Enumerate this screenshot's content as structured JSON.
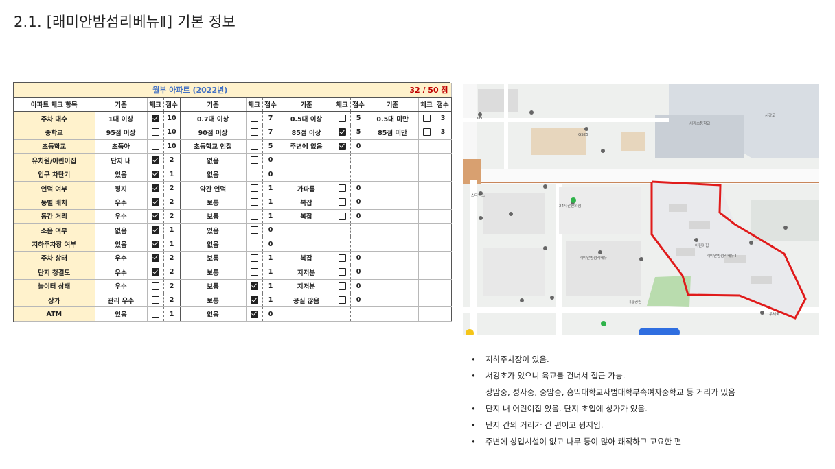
{
  "page_title": "2.1. [래미안밤섬리베뉴Ⅱ] 기본 정보",
  "sheet": {
    "heading": "월부 아파트 (2022년)",
    "score_total": "32 / 50 점",
    "headers": [
      "아파트 체크 항목",
      "기준",
      "체크",
      "점수",
      "기준",
      "체크",
      "점수",
      "기준",
      "체크",
      "점수",
      "기준",
      "체크",
      "점수"
    ],
    "rows": [
      {
        "item": "주차 대수",
        "groups": [
          {
            "basis": "1대 이상",
            "checked": true,
            "pt": "10"
          },
          {
            "basis": "0.7대 이상",
            "checked": false,
            "pt": "7"
          },
          {
            "basis": "0.5대 이상",
            "checked": false,
            "pt": "5"
          },
          {
            "basis": "0.5대 미만",
            "checked": false,
            "pt": "3"
          }
        ]
      },
      {
        "item": "중학교",
        "groups": [
          {
            "basis": "95점 이상",
            "checked": false,
            "pt": "10"
          },
          {
            "basis": "90점 이상",
            "checked": false,
            "pt": "7"
          },
          {
            "basis": "85점 이상",
            "checked": true,
            "pt": "5"
          },
          {
            "basis": "85점 미만",
            "checked": false,
            "pt": "3"
          }
        ]
      },
      {
        "item": "초등학교",
        "groups": [
          {
            "basis": "초품아",
            "checked": false,
            "pt": "10"
          },
          {
            "basis": "초등학교 인접",
            "checked": false,
            "pt": "5"
          },
          {
            "basis": "주변에 없음",
            "checked": true,
            "pt": "0"
          },
          null
        ]
      },
      {
        "item": "유치원/어린이집",
        "groups": [
          {
            "basis": "단지 내",
            "checked": true,
            "pt": "2"
          },
          {
            "basis": "없음",
            "checked": false,
            "pt": "0"
          },
          null,
          null
        ]
      },
      {
        "item": "입구 차단기",
        "groups": [
          {
            "basis": "있음",
            "checked": true,
            "pt": "1"
          },
          {
            "basis": "없음",
            "checked": false,
            "pt": "0"
          },
          null,
          null
        ]
      },
      {
        "item": "언덕 여부",
        "groups": [
          {
            "basis": "평지",
            "checked": true,
            "pt": "2"
          },
          {
            "basis": "약간 언덕",
            "checked": false,
            "pt": "1"
          },
          {
            "basis": "가파름",
            "checked": false,
            "pt": "0"
          },
          null
        ]
      },
      {
        "item": "동별 배치",
        "groups": [
          {
            "basis": "우수",
            "checked": true,
            "pt": "2"
          },
          {
            "basis": "보통",
            "checked": false,
            "pt": "1"
          },
          {
            "basis": "복잡",
            "checked": false,
            "pt": "0"
          },
          null
        ]
      },
      {
        "item": "동간 거리",
        "groups": [
          {
            "basis": "우수",
            "checked": true,
            "pt": "2"
          },
          {
            "basis": "보통",
            "checked": false,
            "pt": "1"
          },
          {
            "basis": "복잡",
            "checked": false,
            "pt": "0"
          },
          null
        ]
      },
      {
        "item": "소음 여부",
        "groups": [
          {
            "basis": "없음",
            "checked": true,
            "pt": "1"
          },
          {
            "basis": "있음",
            "checked": false,
            "pt": "0"
          },
          null,
          null
        ]
      },
      {
        "item": "지하주차장 여부",
        "groups": [
          {
            "basis": "있음",
            "checked": true,
            "pt": "1"
          },
          {
            "basis": "없음",
            "checked": false,
            "pt": "0"
          },
          null,
          null
        ]
      },
      {
        "item": "주차 상태",
        "groups": [
          {
            "basis": "우수",
            "checked": true,
            "pt": "2"
          },
          {
            "basis": "보통",
            "checked": false,
            "pt": "1"
          },
          {
            "basis": "복잡",
            "checked": false,
            "pt": "0"
          },
          null
        ]
      },
      {
        "item": "단지 청결도",
        "groups": [
          {
            "basis": "우수",
            "checked": true,
            "pt": "2"
          },
          {
            "basis": "보통",
            "checked": false,
            "pt": "1"
          },
          {
            "basis": "지저분",
            "checked": false,
            "pt": "0"
          },
          null
        ]
      },
      {
        "item": "놀이터 상태",
        "groups": [
          {
            "basis": "우수",
            "checked": false,
            "pt": "2"
          },
          {
            "basis": "보통",
            "checked": true,
            "pt": "1"
          },
          {
            "basis": "지저분",
            "checked": false,
            "pt": "0"
          },
          null
        ]
      },
      {
        "item": "상가",
        "groups": [
          {
            "basis": "관리 우수",
            "checked": false,
            "pt": "2"
          },
          {
            "basis": "보통",
            "checked": true,
            "pt": "1"
          },
          {
            "basis": "공실 많음",
            "checked": false,
            "pt": "0"
          },
          null
        ]
      },
      {
        "item": "ATM",
        "groups": [
          {
            "basis": "있음",
            "checked": false,
            "pt": "1"
          },
          {
            "basis": "없음",
            "checked": true,
            "pt": "0"
          },
          null,
          null
        ]
      }
    ]
  },
  "map": {
    "labels": [
      "KFC",
      "GS25",
      "스타벅스",
      "24시간편의점",
      "서강초등학교",
      "래미안밤섬리베뉴Ⅱ",
      "래미안밤섬리베뉴Ⅰ",
      "어린이집",
      "서강고",
      "대흥공원",
      "우체국"
    ],
    "colors": {
      "route": "#e01b1b",
      "road": "#ffffff",
      "rail": "#c8865a",
      "park": "#b9dcae",
      "building": "#d9d9d9"
    }
  },
  "notes": [
    {
      "lines": [
        "지하주차장이 있음."
      ]
    },
    {
      "lines": [
        "서강초가 있으니 육교를 건너서 접근 가능.",
        "상암중, 성사중, 중암중, 홍익대학교사범대학부속여자중학교 등 거리가 있음"
      ]
    },
    {
      "lines": [
        "단지 내 어린이집 있음. 단지 초입에 상가가 있음."
      ]
    },
    {
      "lines": [
        "단지 간의 거리가 긴 편이고 평지임."
      ]
    },
    {
      "lines": [
        "주변에 상업시설이 없고 나무 등이 많아 쾌적하고 고요한 편"
      ]
    }
  ],
  "bullet_char": "•"
}
